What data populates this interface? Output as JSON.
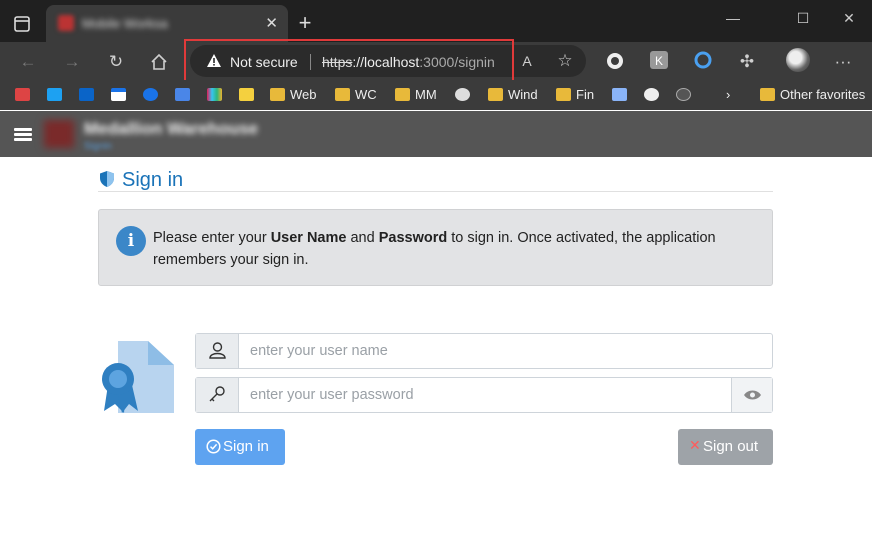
{
  "browser": {
    "tab_title": "Mobile Worksa",
    "address": {
      "warning": "Not secure",
      "scheme": "https",
      "host": "://localhost",
      "rest": ":3000/signin"
    },
    "favorites": [
      "Web",
      "WC",
      "MM",
      "Wind",
      "Fin"
    ],
    "other_favorites": "Other favorites"
  },
  "app": {
    "title": "Medallion Warehouse",
    "subtitle": "Signin"
  },
  "page": {
    "heading": "Sign in",
    "info_message": {
      "part1": "Please enter your ",
      "user_name": "User Name",
      "part2": " and ",
      "password": "Password",
      "part3": " to sign in. Once activated, the application remembers your sign in."
    },
    "username_placeholder": "enter your user name",
    "password_placeholder": "enter your user password",
    "signin_label": "Sign in",
    "signout_label": "Sign out"
  },
  "colors": {
    "accent": "#1a73b8",
    "signin_button": "#5ea3f0",
    "signout_button": "#9ea3a8",
    "highlight_box": "#e03a3a"
  }
}
